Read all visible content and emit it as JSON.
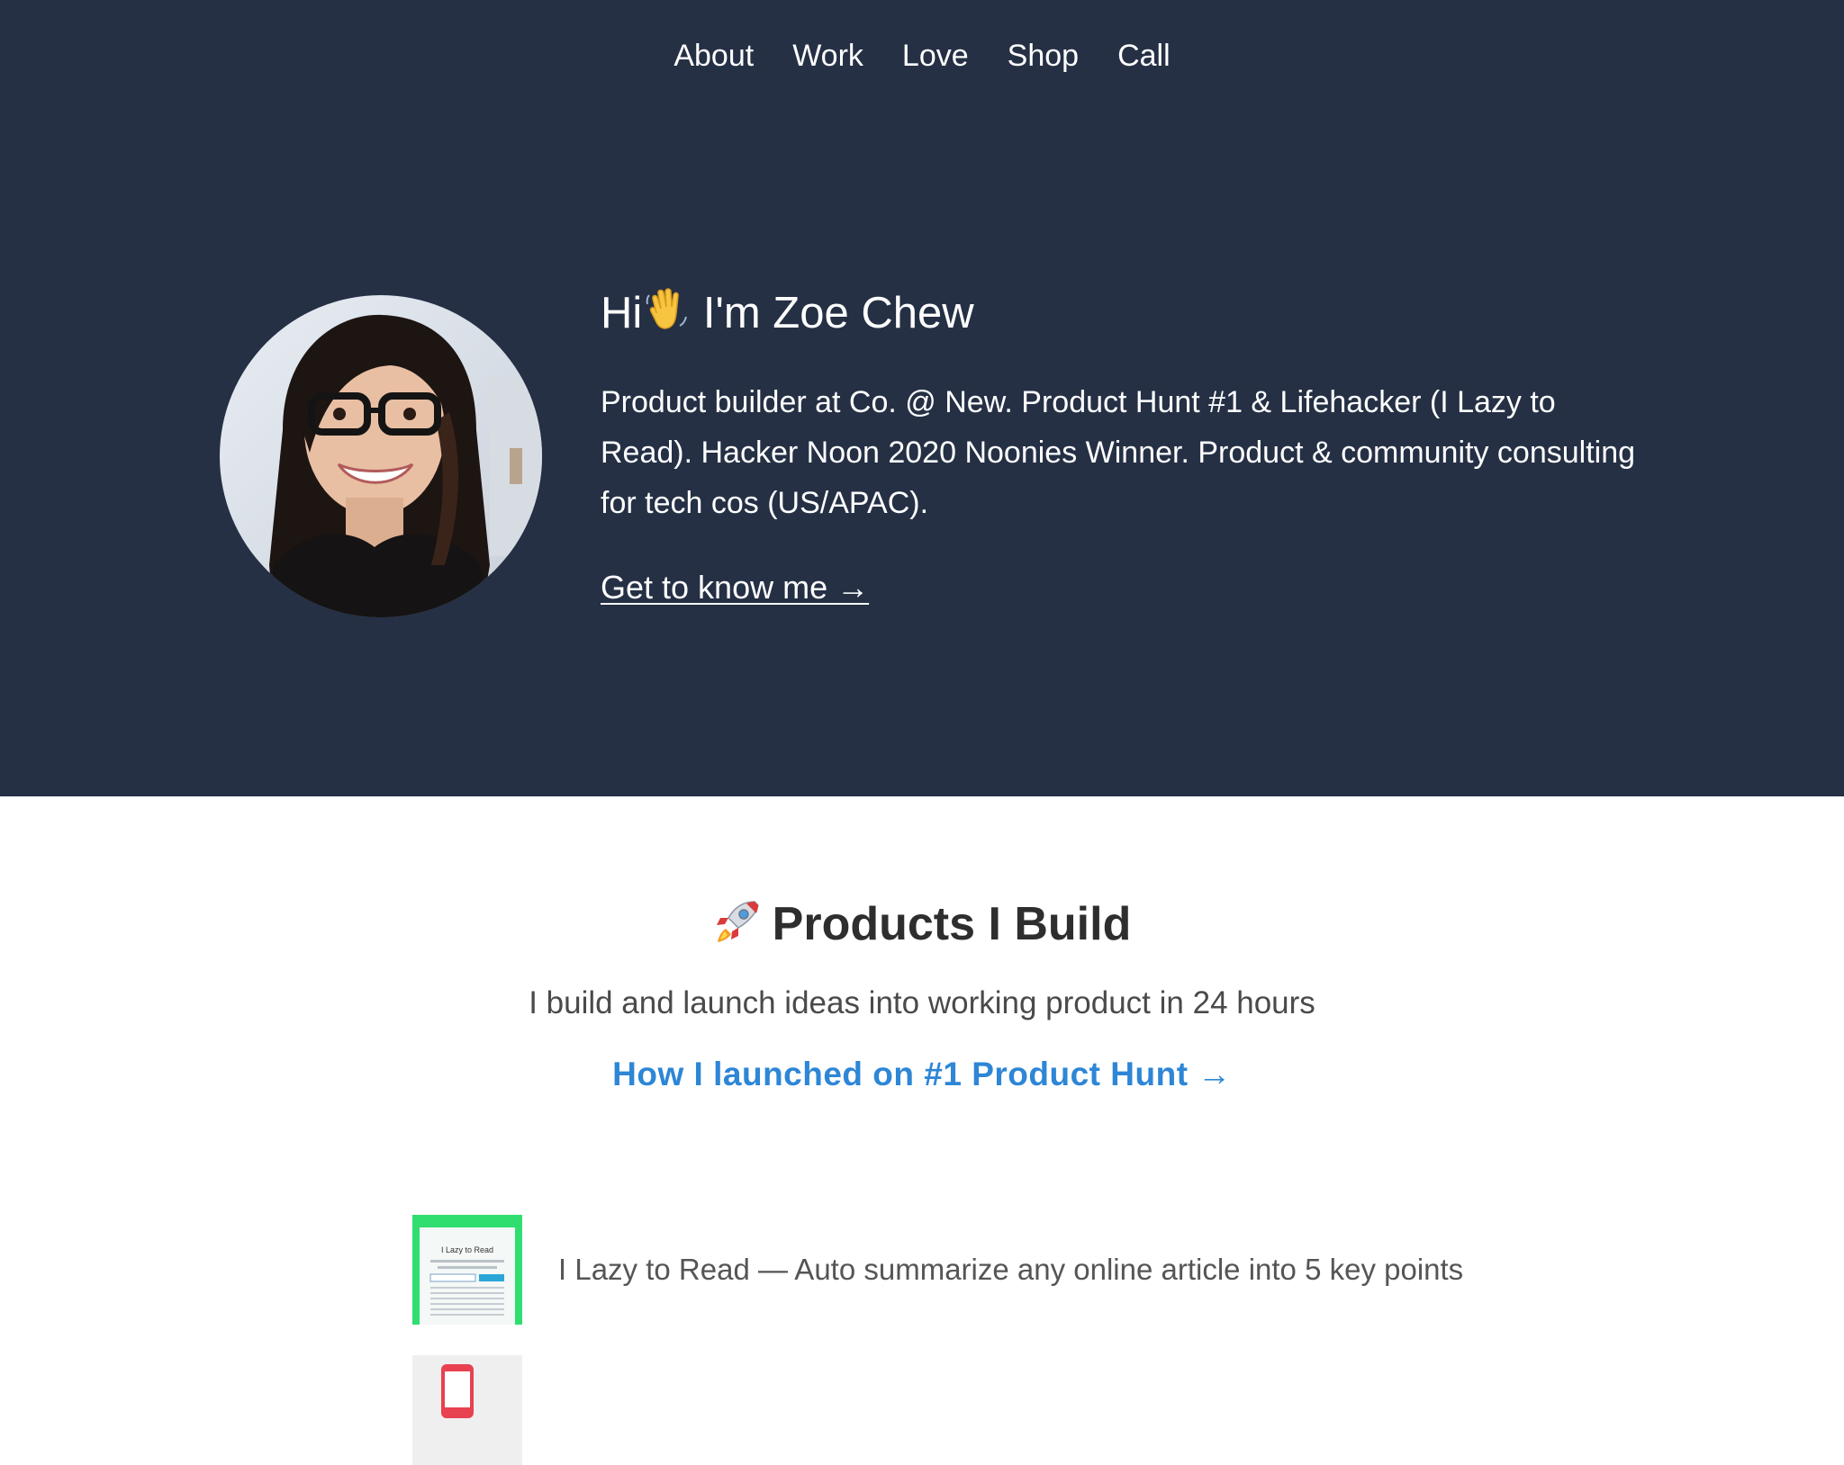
{
  "nav": {
    "items": [
      {
        "label": "About"
      },
      {
        "label": "Work"
      },
      {
        "label": "Love"
      },
      {
        "label": "Shop"
      },
      {
        "label": "Call"
      }
    ]
  },
  "hero": {
    "greeting": "Hi",
    "wave_icon": "waving-hand-emoji",
    "name_line": "I'm Zoe Chew",
    "bio": "Product builder at Co. @ New. Product Hunt #1 & Lifehacker (I Lazy to Read). Hacker Noon 2020 Noonies Winner. Product & community consulting for tech cos (US/APAC).",
    "cta_label": "Get to know me →",
    "background_color": "#253045"
  },
  "products": {
    "rocket_icon": "rocket-emoji",
    "title": "Products I Build",
    "subtitle": "I build and launch ideas into working product in 24 hours",
    "link_label": "How I launched on #1 Product Hunt →",
    "link_color": "#2d86d6",
    "items": [
      {
        "description": "I Lazy to Read — Auto summarize any online article into 5 key points",
        "thumb_title": "I Lazy to Read"
      },
      {
        "description": ""
      }
    ]
  }
}
